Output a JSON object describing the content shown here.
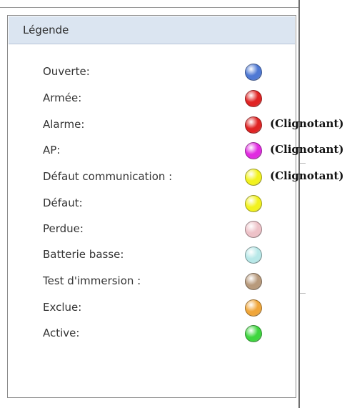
{
  "legend": {
    "title": "Légende",
    "items": [
      {
        "label": "Ouverte:",
        "color": "#4f79d4",
        "note": ""
      },
      {
        "label": "Armée:",
        "color": "#e02424",
        "note": ""
      },
      {
        "label": "Alarme:",
        "color": "#e02424",
        "note": "(Clignotant)"
      },
      {
        "label": "AP:",
        "color": "#e12be1",
        "note": "(Clignotant)"
      },
      {
        "label": "Défaut communication :",
        "color": "#f2f21f",
        "note": "(Clignotant)"
      },
      {
        "label": "Défaut:",
        "color": "#f2f21f",
        "note": ""
      },
      {
        "label": "Perdue:",
        "color": "#eec2c8",
        "note": ""
      },
      {
        "label": "Batterie basse:",
        "color": "#b8e8e8",
        "note": ""
      },
      {
        "label": "Test d'immersion :",
        "color": "#b89a7c",
        "note": ""
      },
      {
        "label": "Exclue:",
        "color": "#f0a63a",
        "note": ""
      },
      {
        "label": "Active:",
        "color": "#3fd63f",
        "note": ""
      }
    ]
  }
}
